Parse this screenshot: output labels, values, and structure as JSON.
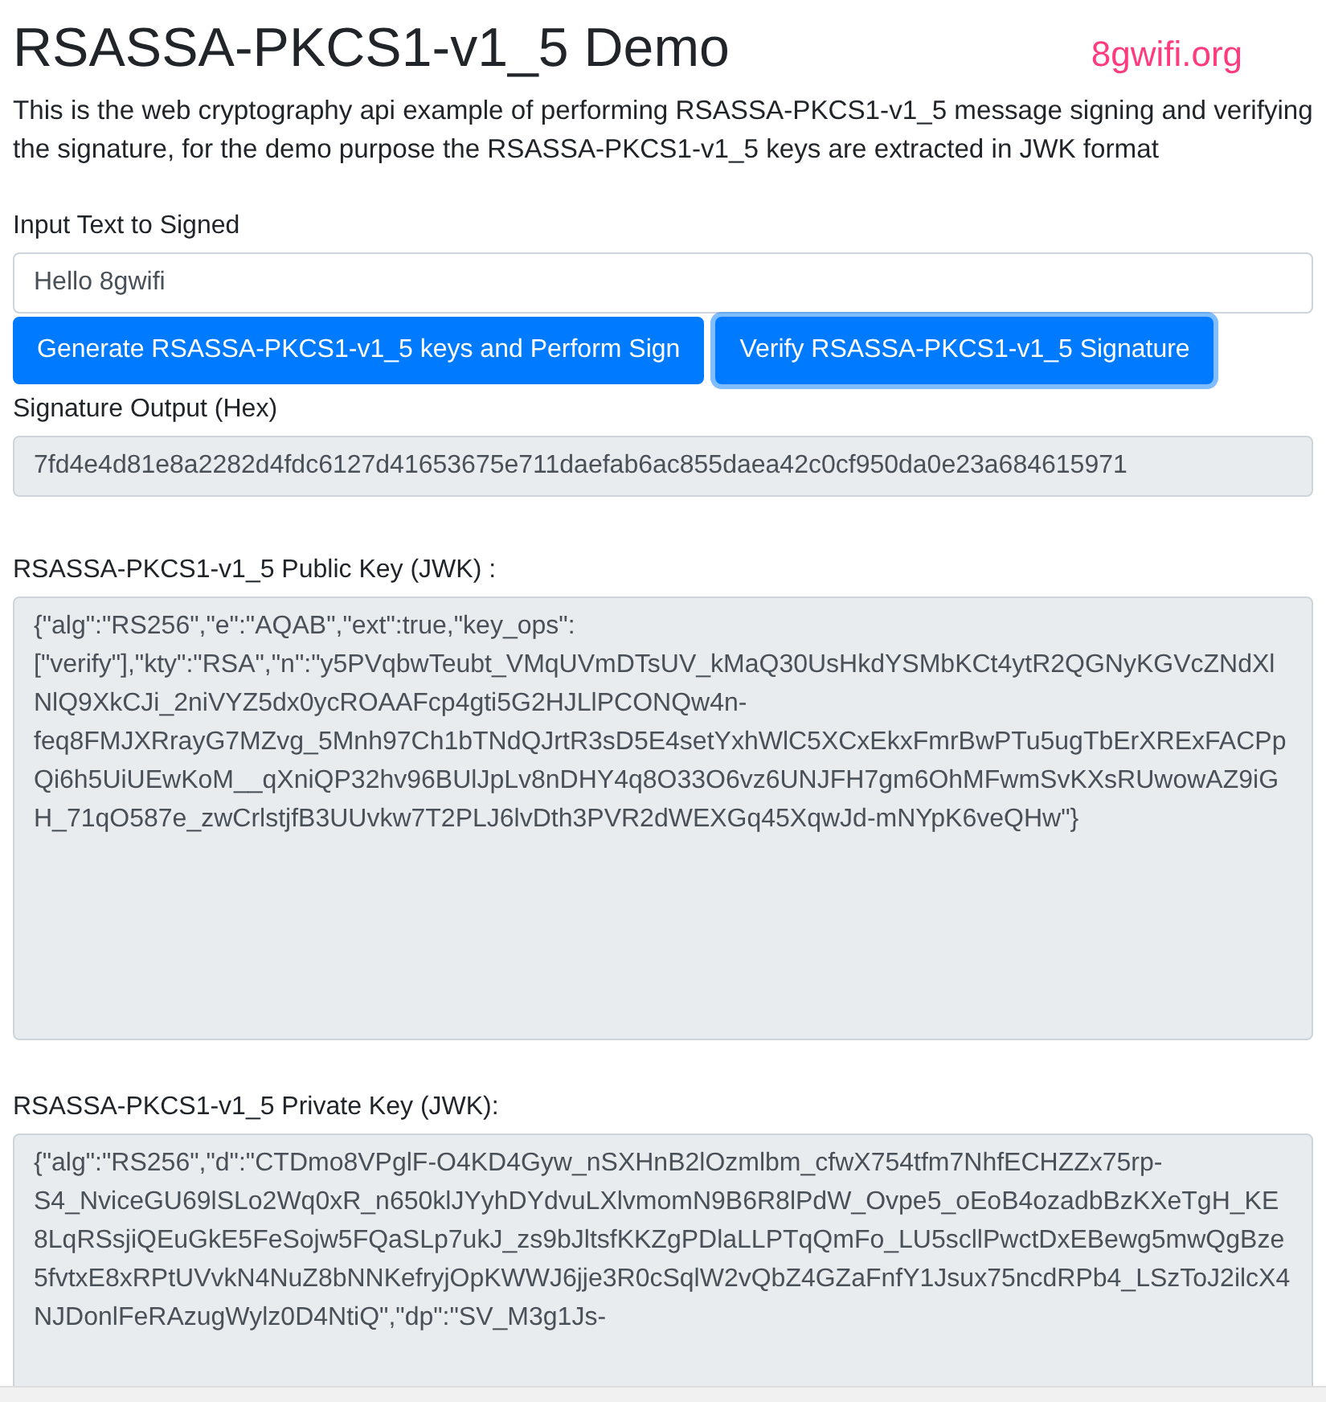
{
  "header": {
    "title": "RSASSA-PKCS1-v1_5 Demo",
    "site": "8gwifi.org"
  },
  "description": "This is the web cryptography api example of performing RSASSA-PKCS1-v1_5 message signing and verifying the signature, for the demo purpose the RSASSA-PKCS1-v1_5 keys are extracted in JWK format",
  "input": {
    "label": "Input Text to Signed",
    "value": "Hello 8gwifi"
  },
  "buttons": [
    {
      "label": "Generate RSASSA-PKCS1-v1_5 keys and Perform Sign",
      "focused": false
    },
    {
      "label": "Verify RSASSA-PKCS1-v1_5 Signature",
      "focused": true
    }
  ],
  "signature": {
    "label": "Signature Output (Hex)",
    "value": "7fd4e4d81e8a2282d4fdc6127d41653675e711daefab6ac855daea42c0cf950da0e23a684615971"
  },
  "public_key": {
    "label": "RSASSA-PKCS1-v1_5 Public Key (JWK) :",
    "value": "{\"alg\":\"RS256\",\"e\":\"AQAB\",\"ext\":true,\"key_ops\":[\"verify\"],\"kty\":\"RSA\",\"n\":\"y5PVqbwTeubt_VMqUVmDTsUV_kMaQ30UsHkdYSMbKCt4ytR2QGNyKGVcZNdXlNlQ9XkCJi_2niVYZ5dx0ycROAAFcp4gti5G2HJLlPCONQw4n-feq8FMJXRrayG7MZvg_5Mnh97Ch1bTNdQJrtR3sD5E4setYxhWlC5XCxEkxFmrBwPTu5ugTbErXRExFACPpQi6h5UiUEwKoM__qXniQP32hv96BUlJpLv8nDHY4q8O33O6vz6UNJFH7gm6OhMFwmSvKXsRUwowAZ9iGH_71qO587e_zwCrlstjfB3UUvkw7T2PLJ6lvDth3PVR2dWEXGq45XqwJd-mNYpK6veQHw\"}"
  },
  "private_key": {
    "label": "RSASSA-PKCS1-v1_5 Private Key (JWK):",
    "value": "{\"alg\":\"RS256\",\"d\":\"CTDmo8VPglF-O4KD4Gyw_nSXHnB2lOzmlbm_cfwX754tfm7NhfECHZZx75rp-S4_NviceGU69lSLo2Wq0xR_n650klJYyhDYdvuLXlvmomN9B6R8lPdW_Ovpe5_oEoB4ozadbBzKXeTgH_KE8LqRSsjiQEuGkE5FeSojw5FQaSLp7ukJ_zs9bJltsfKKZgPDlaLLPTqQmFo_LU5scllPwctDxEBewg5mwQgBze5fvtxE8xRPtUVvkN4NuZ8bNNKefryjOpKWWJ6jje3R0cSqlW2vQbZ4GZaFnfY1Jsux75ncdRPb4_LSzToJ2ilcX4NJDonlFeRAzugWylz0D4NtiQ\",\"dp\":\"SV_M3g1Js-"
  }
}
